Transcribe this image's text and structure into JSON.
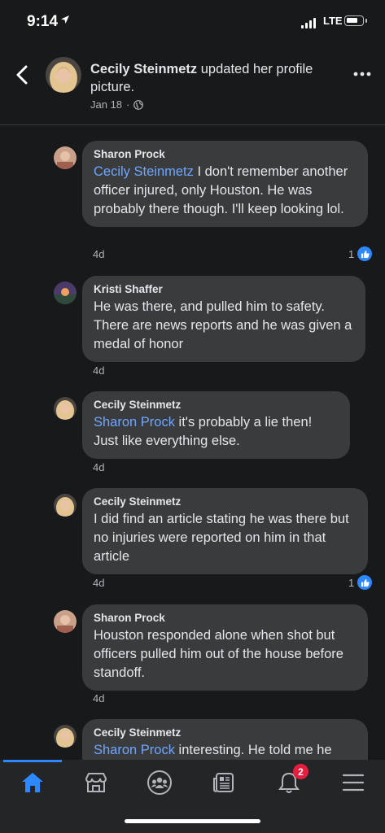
{
  "status_bar": {
    "time": "9:14",
    "network": "LTE"
  },
  "header": {
    "author": "Cecily Steinmetz",
    "action": "updated her profile picture.",
    "date": "Jan 18",
    "separator": "·"
  },
  "comments": [
    {
      "author": "Sharon Prock",
      "mention": "Cecily Steinmetz",
      "text": " I don't remember another officer injured, only Houston. He was probably there though. I'll keep looking lol.",
      "time": "4d",
      "likes": "1",
      "avatar_color": "#c9a089"
    },
    {
      "author": "Kristi Shaffer",
      "mention": "",
      "text": "He was there, and pulled him to safety. There are news reports and he was given a medal of honor",
      "time": "4d",
      "likes": "",
      "avatar_color": "#7a5c8a"
    },
    {
      "author": "Cecily Steinmetz",
      "mention": "Sharon Prock",
      "text": " it's probably a lie then! Just like everything else.",
      "time": "4d",
      "likes": "",
      "avatar_color": "#e3c08d"
    },
    {
      "author": "Cecily Steinmetz",
      "mention": "",
      "text": "I did find an article stating he was there but no injuries were reported on him in that article",
      "time": "4d",
      "likes": "1",
      "avatar_color": "#e3c08d"
    },
    {
      "author": "Sharon Prock",
      "mention": "",
      "text": "Houston responded alone when shot but officers pulled him out of the house before standoff.",
      "time": "4d",
      "likes": "",
      "avatar_color": "#c9a089"
    },
    {
      "author": "Cecily Steinmetz",
      "mention": "Sharon Prock",
      "text": " interesting. He told me he",
      "time": "",
      "likes": "",
      "avatar_color": "#e3c08d"
    }
  ],
  "tabbar": {
    "tabs": [
      {
        "icon": "home-icon",
        "active": true
      },
      {
        "icon": "marketplace-icon",
        "active": false
      },
      {
        "icon": "groups-icon",
        "active": false
      },
      {
        "icon": "news-icon",
        "active": false
      },
      {
        "icon": "bell-icon",
        "active": false
      },
      {
        "icon": "menu-icon",
        "active": false
      }
    ],
    "notifications_count": "2"
  },
  "colors": {
    "accent": "#2d88ff",
    "mention": "#6ea6ff",
    "badge": "#e41e3f",
    "bubble": "#3a3b3c",
    "background": "#18191a"
  }
}
